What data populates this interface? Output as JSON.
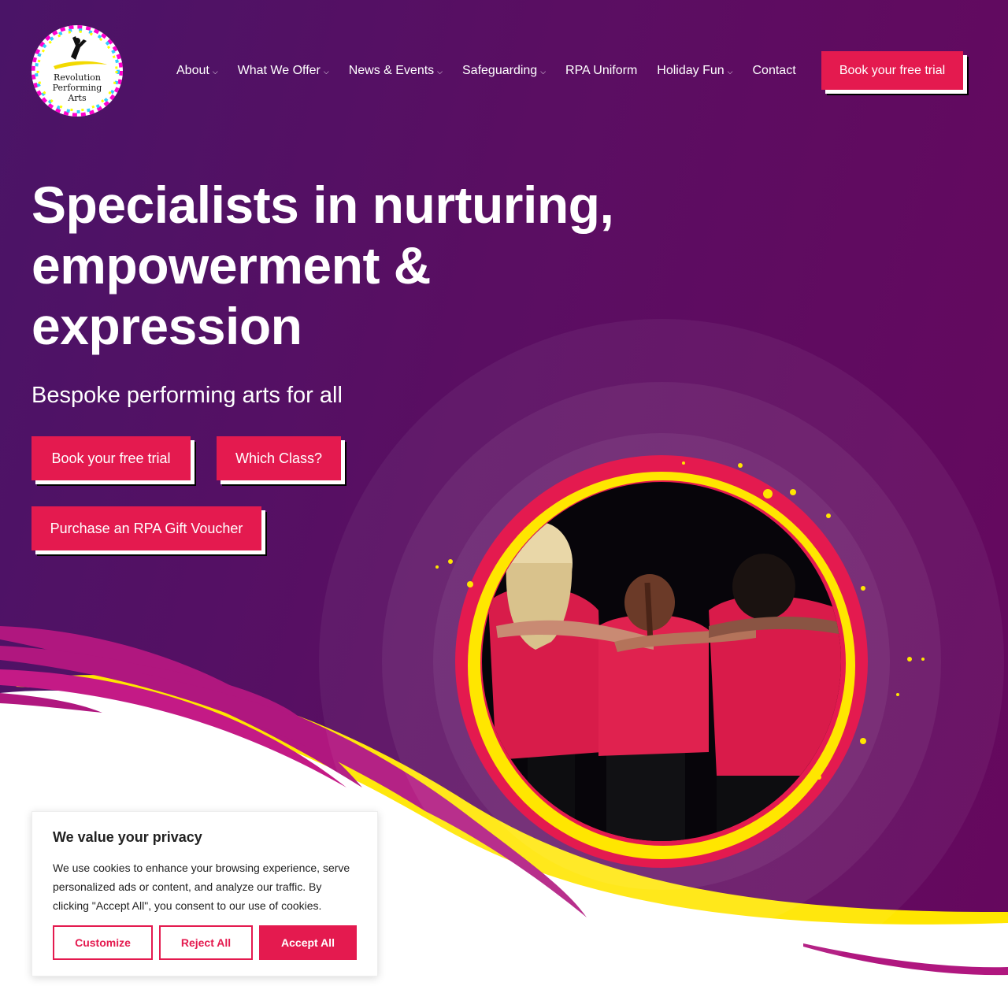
{
  "logo": {
    "lines": [
      "Revolution",
      "Performing",
      "Arts"
    ]
  },
  "nav": {
    "items": [
      {
        "label": "About",
        "has_dropdown": true
      },
      {
        "label": "What We Offer",
        "has_dropdown": true
      },
      {
        "label": "News & Events",
        "has_dropdown": true
      },
      {
        "label": "Safeguarding",
        "has_dropdown": true
      },
      {
        "label": "RPA Uniform",
        "has_dropdown": false
      },
      {
        "label": "Holiday Fun",
        "has_dropdown": true
      },
      {
        "label": "Contact",
        "has_dropdown": false
      }
    ],
    "dropdown_glyph": "⌵",
    "cta": "Book your free trial"
  },
  "hero": {
    "title": "Specialists in nurturing, empowerment & expression",
    "subtitle": "Bespoke performing arts for all",
    "buttons": {
      "trial": "Book your free trial",
      "class": "Which Class?",
      "voucher": "Purchase an RPA Gift Voucher"
    }
  },
  "cookie": {
    "title": "We value your privacy",
    "text": "We use cookies to enhance your browsing experience, serve personalized ads or content, and analyze our traffic. By clicking \"Accept All\", you consent to our use of cookies.",
    "customize": "Customize",
    "reject": "Reject All",
    "accept": "Accept All"
  },
  "colors": {
    "brand_pink": "#e41a4f",
    "purple_dark": "#4a1467",
    "purple_light": "#66085e",
    "yellow": "#ffe600",
    "magenta": "#b0177f"
  }
}
